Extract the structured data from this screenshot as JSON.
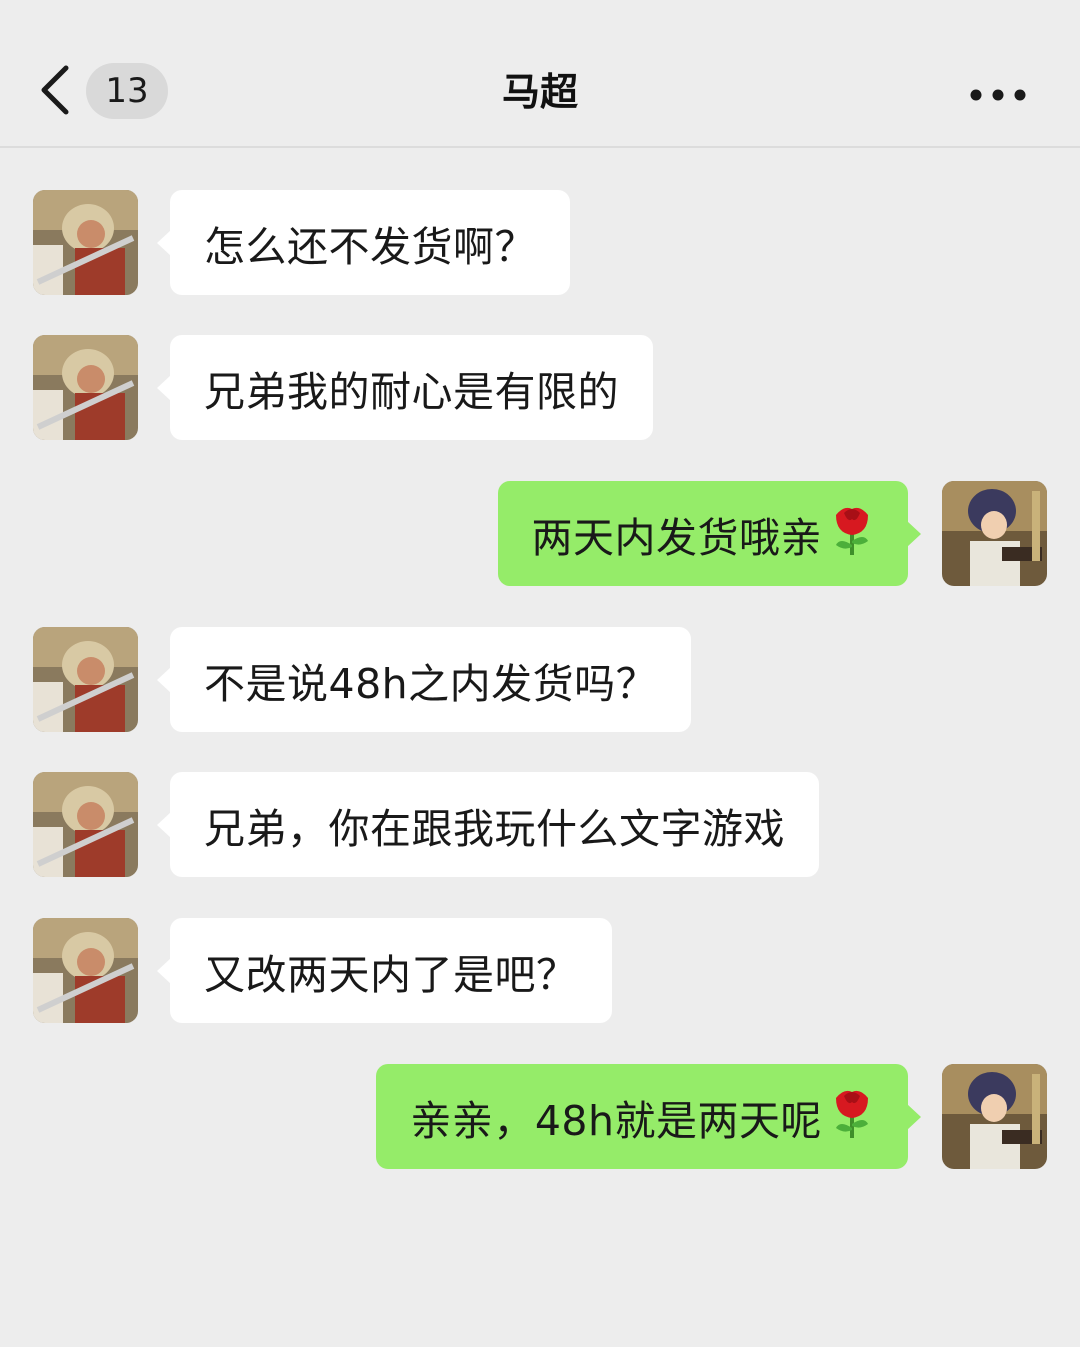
{
  "header": {
    "title": "马超",
    "unread_count": "13",
    "back_icon": "chevron-left-icon",
    "more_icon": "more-horizontal-icon"
  },
  "colors": {
    "background": "#ededed",
    "incoming_bubble": "#ffffff",
    "outgoing_bubble": "#95ec69"
  },
  "messages": [
    {
      "from": "contact",
      "text": "怎么还不发货啊？",
      "emoji": ""
    },
    {
      "from": "contact",
      "text": "兄弟我的耐心是有限的",
      "emoji": ""
    },
    {
      "from": "me",
      "text": "两天内发货哦亲",
      "emoji": "rose-icon"
    },
    {
      "from": "contact",
      "text": "不是说48h之内发货吗？",
      "emoji": ""
    },
    {
      "from": "contact",
      "text": "兄弟，你在跟我玩什么文字游戏",
      "emoji": ""
    },
    {
      "from": "contact",
      "text": "又改两天内了是吧？",
      "emoji": ""
    },
    {
      "from": "me",
      "text": "亲亲，48h就是两天呢",
      "emoji": "rose-icon"
    }
  ]
}
